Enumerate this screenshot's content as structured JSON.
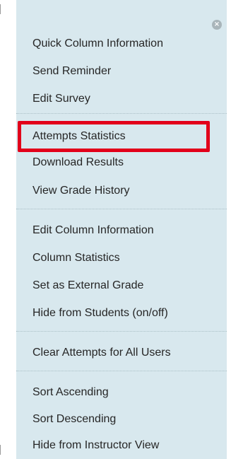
{
  "menu": {
    "close_icon": "x-icon",
    "items": [
      {
        "label": "Quick Column Information"
      },
      {
        "label": "Send Reminder"
      },
      {
        "label": "Edit Survey"
      },
      {
        "label": "Attempts Statistics"
      },
      {
        "label": "Download Results"
      },
      {
        "label": "View Grade History"
      },
      {
        "label": "Edit Column Information"
      },
      {
        "label": "Column Statistics"
      },
      {
        "label": "Set as External Grade"
      },
      {
        "label": "Hide from Students (on/off)"
      },
      {
        "label": "Clear Attempts for All Users"
      },
      {
        "label": "Sort Ascending"
      },
      {
        "label": "Sort Descending"
      },
      {
        "label": "Hide from Instructor View"
      }
    ],
    "highlighted_item": "Attempts Statistics",
    "colors": {
      "menu_background": "#d8e8ee",
      "highlight_border": "#e2001a",
      "text": "#262626"
    }
  }
}
